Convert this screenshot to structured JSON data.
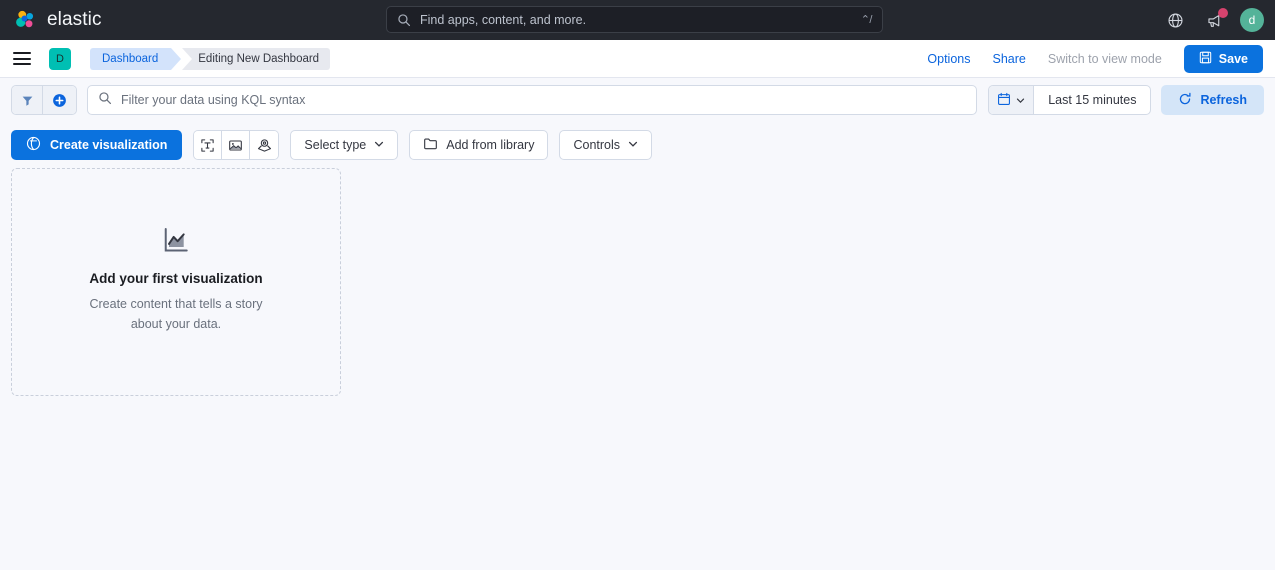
{
  "header": {
    "brand_name": "elastic",
    "logo_icon": "elastic-logo",
    "search": {
      "placeholder": "Find apps, content, and more.",
      "value": "",
      "icon": "search-icon",
      "shortcut": "⌃/"
    },
    "help_icon": "help-support-icon",
    "notifications_icon": "news-feed-icon",
    "notifications_badge": "",
    "avatar_initial": "d"
  },
  "breadcrumb_bar": {
    "menu_icon": "hamburger-menu-icon",
    "space_badge": "D",
    "crumbs": [
      {
        "label": "Dashboard",
        "active": true
      },
      {
        "label": "Editing New Dashboard",
        "active": false
      }
    ],
    "options_label": "Options",
    "share_label": "Share",
    "view_mode_label": "Switch to view mode",
    "save_label": "Save",
    "save_icon": "save-disk-icon"
  },
  "query_bar": {
    "filter_icon": "filter-icon",
    "add_filter_icon": "add-circle-icon",
    "search_icon": "search-icon",
    "kql_placeholder": "Filter your data using KQL syntax",
    "kql_value": "",
    "calendar_icon": "calendar-icon",
    "chevron_icon": "chevron-down-icon",
    "time_range": "Last 15 minutes",
    "refresh_label": "Refresh",
    "refresh_icon": "refresh-icon"
  },
  "toolbar": {
    "create_visualization_label": "Create visualization",
    "create_visualization_icon": "lens-icon",
    "text_icon": "text-panel-icon",
    "image_icon": "image-panel-icon",
    "maps_icon": "maps-panel-icon",
    "select_type_label": "Select type",
    "select_type_icon": "chevron-down-icon",
    "add_from_library_label": "Add from library",
    "add_from_library_icon": "folder-icon",
    "controls_label": "Controls",
    "controls_icon": "chevron-down-icon"
  },
  "empty_state": {
    "icon": "area-chart-icon",
    "title": "Add your first visualization",
    "subtitle": "Create content that tells a story about your data."
  },
  "colors": {
    "header_bg": "#25282F",
    "accent_blue": "#0B72DE",
    "link_blue": "#0B64DD",
    "space_teal": "#00BFB3",
    "avatar_teal": "#54B399",
    "badge_pink": "#D6436E",
    "page_bg": "#F7F8FC",
    "refresh_bg": "#D4E5F8"
  }
}
